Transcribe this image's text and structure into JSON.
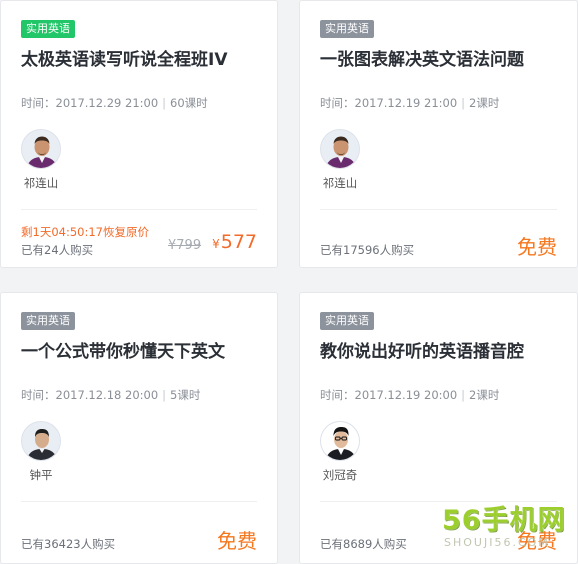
{
  "courses": [
    {
      "tag": "实用英语",
      "tag_color": "#20c667",
      "title": "太极英语读写听说全程班IV",
      "time_label": "时间：",
      "date": "2017.12.29 21:00",
      "sep": "|",
      "lessons": "60课时",
      "teacher": "祁连山",
      "countdown": "剩1天04:50:17恢复原价",
      "buyers": "已有24人购买",
      "original_price": "¥799",
      "price_symbol": "¥",
      "price": "577"
    },
    {
      "tag": "实用英语",
      "tag_color": "#8c939d",
      "title": "一张图表解决英文语法问题",
      "time_label": "时间：",
      "date": "2017.12.19 21:00",
      "sep": "|",
      "lessons": "2课时",
      "teacher": "祁连山",
      "buyers": "已有17596人购买",
      "price": "免费"
    },
    {
      "tag": "实用英语",
      "tag_color": "#8c939d",
      "title": "一个公式带你秒懂天下英文",
      "time_label": "时间：",
      "date": "2017.12.18 20:00",
      "sep": "|",
      "lessons": "5课时",
      "teacher": "钟平",
      "buyers": "已有36423人购买",
      "price": "免费"
    },
    {
      "tag": "实用英语",
      "tag_color": "#8c939d",
      "title": "教你说出好听的英语播音腔",
      "time_label": "时间：",
      "date": "2017.12.19 20:00",
      "sep": "|",
      "lessons": "2课时",
      "teacher": "刘冠奇",
      "buyers": "已有8689人购买",
      "price": "免费"
    }
  ],
  "colors": {
    "accent_orange": "#f26b2a",
    "tag_gray": "#8c939d",
    "tag_green": "#20c667"
  },
  "watermark": {
    "main": "56手机网",
    "sub": "SHOUJI56.COM"
  }
}
